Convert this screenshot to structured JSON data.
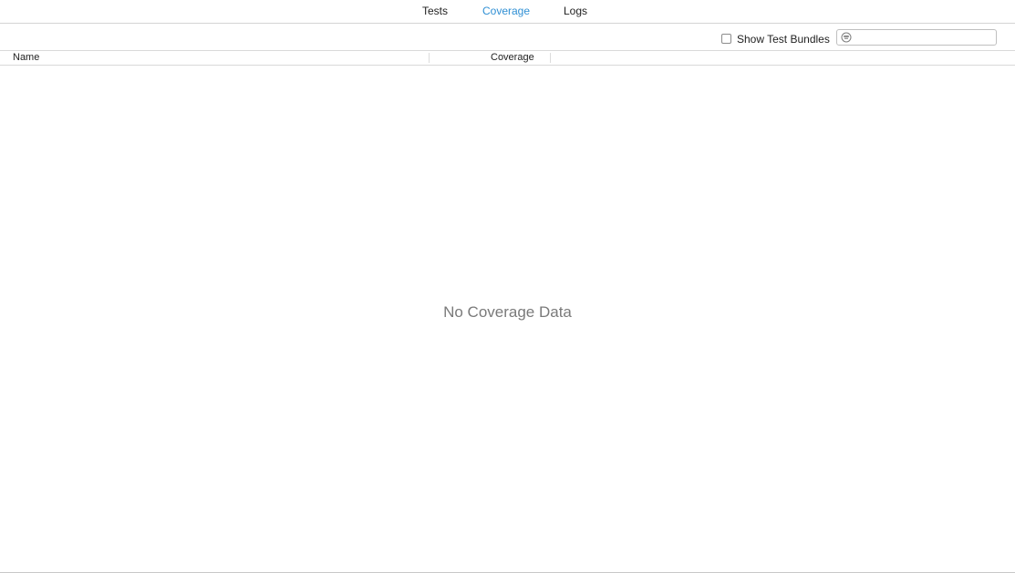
{
  "tabs": [
    {
      "label": "Tests",
      "active": false
    },
    {
      "label": "Coverage",
      "active": true
    },
    {
      "label": "Logs",
      "active": false
    }
  ],
  "toolbar": {
    "show_test_bundles_label": "Show Test Bundles",
    "show_test_bundles_checked": false,
    "filter": {
      "value": "",
      "placeholder": "",
      "icon": "filter-icon"
    }
  },
  "table": {
    "columns": [
      "Name",
      "Coverage"
    ],
    "rows": []
  },
  "empty_state": {
    "message": "No Coverage Data"
  },
  "colors": {
    "accent": "#2f8fd4",
    "muted_text": "#7a7a7a"
  }
}
